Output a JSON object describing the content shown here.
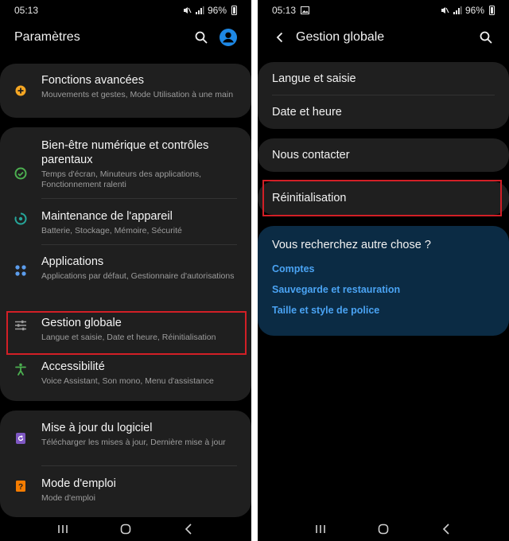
{
  "left": {
    "status": {
      "time": "05:13",
      "battery": "96%"
    },
    "title": "Paramètres",
    "groups": [
      {
        "items": [
          {
            "title": "Fonctions avancées",
            "subtitle": "Mouvements et gestes, Mode Utilisation à une main",
            "icon": "gear-plus-icon",
            "color": "#f5a623"
          }
        ]
      },
      {
        "items": [
          {
            "title": "Bien-être numérique et contrôles parentaux",
            "subtitle": "Temps d'écran, Minuteurs des applications, Fonctionnement ralenti",
            "icon": "wellbeing-icon",
            "color": "#4caf50"
          },
          {
            "title": "Maintenance de l'appareil",
            "subtitle": "Batterie, Stockage, Mémoire, Sécurité",
            "icon": "device-care-icon",
            "color": "#26a69a"
          },
          {
            "title": "Applications",
            "subtitle": "Applications par défaut, Gestionnaire d'autorisations",
            "icon": "apps-icon",
            "color": "#5c9ded"
          }
        ]
      },
      {
        "items": [
          {
            "title": "Gestion globale",
            "subtitle": "Langue et saisie, Date et heure, Réinitialisation",
            "icon": "sliders-icon",
            "color": "#9e9e9e"
          },
          {
            "title": "Accessibilité",
            "subtitle": "Voice Assistant, Son mono, Menu d'assistance",
            "icon": "accessibility-icon",
            "color": "#4caf50"
          }
        ]
      },
      {
        "items": [
          {
            "title": "Mise à jour du logiciel",
            "subtitle": "Télécharger les mises à jour, Dernière mise à jour",
            "icon": "software-update-icon",
            "color": "#7e57c2"
          },
          {
            "title": "Mode d'emploi",
            "subtitle": "Mode d'emploi",
            "icon": "user-manual-icon",
            "color": "#f57c00"
          }
        ]
      }
    ]
  },
  "right": {
    "status": {
      "time": "05:13",
      "battery": "96%"
    },
    "title": "Gestion globale",
    "items": {
      "language": "Langue et saisie",
      "datetime": "Date et heure",
      "contact": "Nous contacter",
      "reset": "Réinitialisation"
    },
    "suggest": {
      "title": "Vous recherchez autre chose ?",
      "links": [
        "Comptes",
        "Sauvegarde et restauration",
        "Taille et style de police"
      ]
    }
  },
  "colors": {
    "highlight": "#d21f26",
    "link": "#4aa3f3",
    "card": "#1f1f1f",
    "blue_card": "#0b2b44"
  }
}
